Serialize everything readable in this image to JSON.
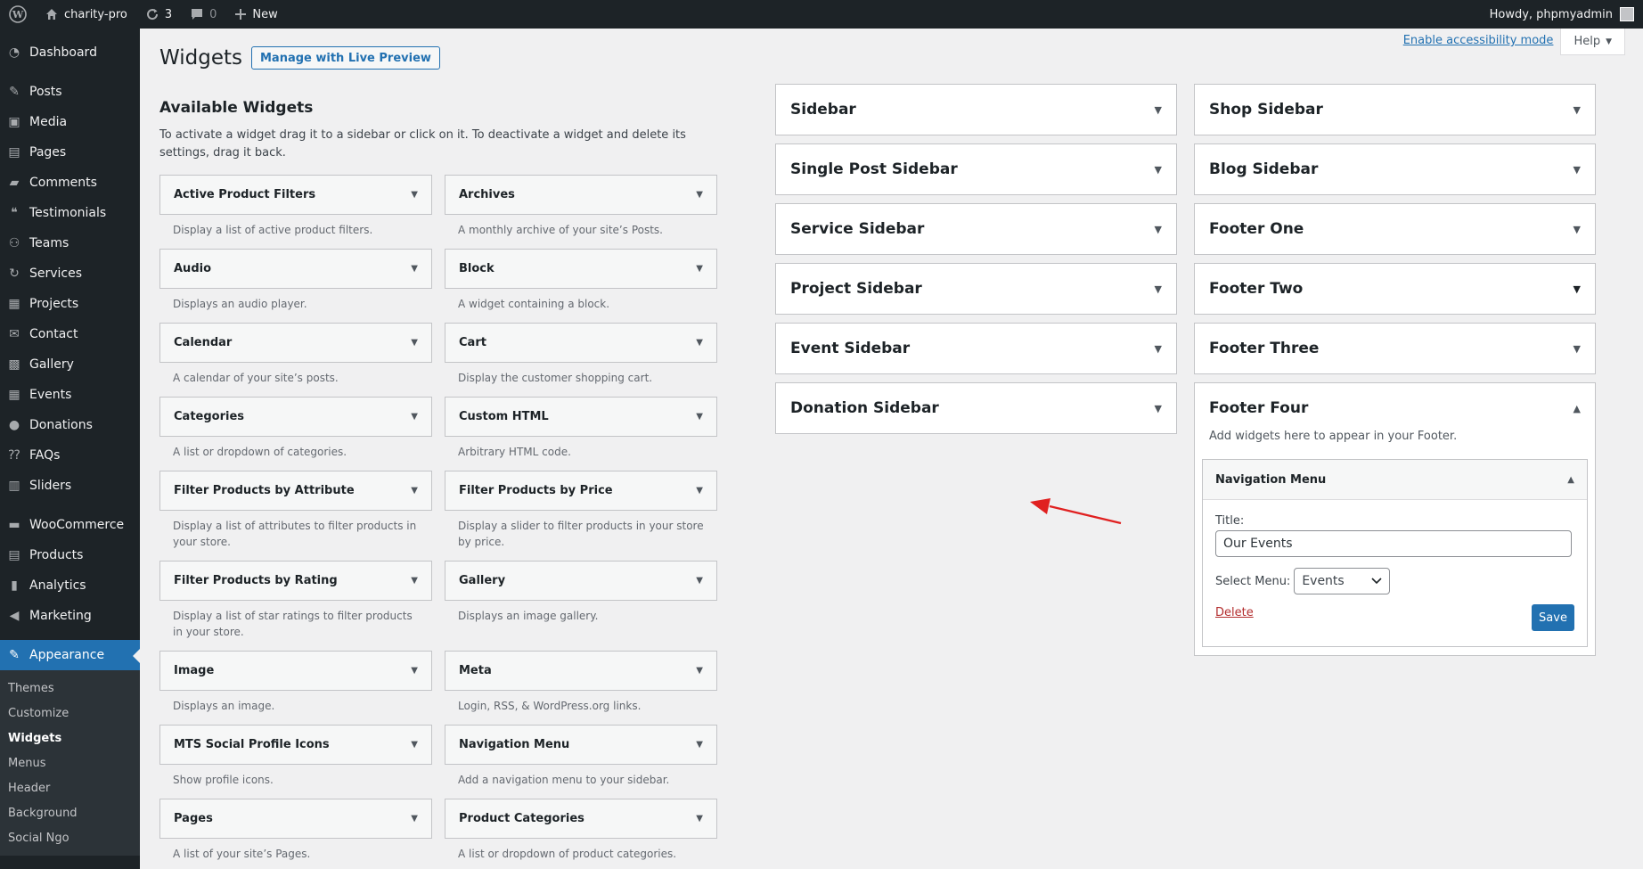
{
  "adminbar": {
    "site_name": "charity-pro",
    "updates_count": "3",
    "comments_count": "0",
    "new_label": "New",
    "howdy": "Howdy, phpmyadmin"
  },
  "menu": {
    "items": [
      {
        "label": "Dashboard",
        "icon": "dashboard-icon"
      },
      {
        "label": "Posts",
        "icon": "pin-icon"
      },
      {
        "label": "Media",
        "icon": "media-icon"
      },
      {
        "label": "Pages",
        "icon": "pages-icon"
      },
      {
        "label": "Comments",
        "icon": "comments-icon"
      },
      {
        "label": "Testimonials",
        "icon": "testimonials-icon"
      },
      {
        "label": "Teams",
        "icon": "teams-icon"
      },
      {
        "label": "Services",
        "icon": "services-icon"
      },
      {
        "label": "Projects",
        "icon": "projects-icon"
      },
      {
        "label": "Contact",
        "icon": "mail-icon"
      },
      {
        "label": "Gallery",
        "icon": "gallery-icon"
      },
      {
        "label": "Events",
        "icon": "events-icon"
      },
      {
        "label": "Donations",
        "icon": "donations-icon"
      },
      {
        "label": "FAQs",
        "icon": "faq-icon"
      },
      {
        "label": "Sliders",
        "icon": "sliders-icon"
      },
      {
        "label": "WooCommerce",
        "icon": "woo-icon"
      },
      {
        "label": "Products",
        "icon": "products-icon"
      },
      {
        "label": "Analytics",
        "icon": "analytics-icon"
      },
      {
        "label": "Marketing",
        "icon": "marketing-icon"
      },
      {
        "label": "Appearance",
        "icon": "appearance-icon"
      }
    ],
    "submenu": [
      "Themes",
      "Customize",
      "Widgets",
      "Menus",
      "Header",
      "Background",
      "Social Ngo"
    ]
  },
  "header": {
    "a11y_link": "Enable accessibility mode",
    "help_label": "Help",
    "title": "Widgets",
    "live_preview_label": "Manage with Live Preview"
  },
  "available": {
    "title": "Available Widgets",
    "description": "To activate a widget drag it to a sidebar or click on it. To deactivate a widget and delete its settings, drag it back.",
    "widgets": [
      {
        "name": "Active Product Filters",
        "desc": "Display a list of active product filters."
      },
      {
        "name": "Archives",
        "desc": "A monthly archive of your site’s Posts."
      },
      {
        "name": "Audio",
        "desc": "Displays an audio player."
      },
      {
        "name": "Block",
        "desc": "A widget containing a block."
      },
      {
        "name": "Calendar",
        "desc": "A calendar of your site’s posts."
      },
      {
        "name": "Cart",
        "desc": "Display the customer shopping cart."
      },
      {
        "name": "Categories",
        "desc": "A list or dropdown of categories."
      },
      {
        "name": "Custom HTML",
        "desc": "Arbitrary HTML code."
      },
      {
        "name": "Filter Products by Attribute",
        "desc": "Display a list of attributes to filter products in your store."
      },
      {
        "name": "Filter Products by Price",
        "desc": "Display a slider to filter products in your store by price."
      },
      {
        "name": "Filter Products by Rating",
        "desc": "Display a list of star ratings to filter products in your store."
      },
      {
        "name": "Gallery",
        "desc": "Displays an image gallery."
      },
      {
        "name": "Image",
        "desc": "Displays an image."
      },
      {
        "name": "Meta",
        "desc": "Login, RSS, & WordPress.org links."
      },
      {
        "name": "MTS Social Profile Icons",
        "desc": "Show profile icons."
      },
      {
        "name": "Navigation Menu",
        "desc": "Add a navigation menu to your sidebar."
      },
      {
        "name": "Pages",
        "desc": "A list of your site’s Pages."
      },
      {
        "name": "Product Categories",
        "desc": "A list or dropdown of product categories."
      }
    ]
  },
  "sidebars": {
    "col1": [
      "Sidebar",
      "Single Post Sidebar",
      "Service Sidebar",
      "Project Sidebar",
      "Event Sidebar",
      "Donation Sidebar"
    ],
    "col2": [
      "Shop Sidebar",
      "Blog Sidebar",
      "Footer One",
      "Footer Two",
      "Footer Three"
    ],
    "open": {
      "name": "Footer Four",
      "description": "Add widgets here to appear in your Footer.",
      "widget": {
        "name": "Navigation Menu",
        "title_label": "Title:",
        "title_value": "Our Events",
        "select_label": "Select Menu:",
        "select_value": "Events",
        "delete_label": "Delete",
        "save_label": "Save"
      }
    }
  },
  "colors": {
    "admin_dark": "#1d2327",
    "accent": "#2271b1",
    "delete": "#b32d2e",
    "annotation_arrow": "#e02020"
  }
}
